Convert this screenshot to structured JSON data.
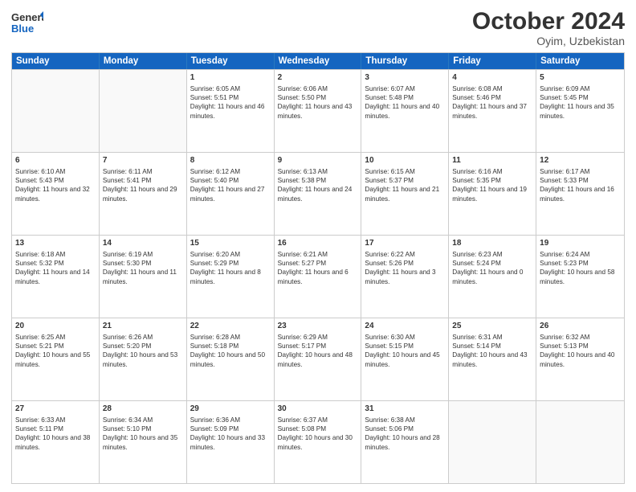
{
  "header": {
    "logo_general": "General",
    "logo_blue": "Blue",
    "month_title": "October 2024",
    "location": "Oyim, Uzbekistan"
  },
  "days_of_week": [
    "Sunday",
    "Monday",
    "Tuesday",
    "Wednesday",
    "Thursday",
    "Friday",
    "Saturday"
  ],
  "weeks": [
    [
      {
        "day": "",
        "sunrise": "",
        "sunset": "",
        "daylight": "",
        "empty": true
      },
      {
        "day": "",
        "sunrise": "",
        "sunset": "",
        "daylight": "",
        "empty": true
      },
      {
        "day": "1",
        "sunrise": "Sunrise: 6:05 AM",
        "sunset": "Sunset: 5:51 PM",
        "daylight": "Daylight: 11 hours and 46 minutes."
      },
      {
        "day": "2",
        "sunrise": "Sunrise: 6:06 AM",
        "sunset": "Sunset: 5:50 PM",
        "daylight": "Daylight: 11 hours and 43 minutes."
      },
      {
        "day": "3",
        "sunrise": "Sunrise: 6:07 AM",
        "sunset": "Sunset: 5:48 PM",
        "daylight": "Daylight: 11 hours and 40 minutes."
      },
      {
        "day": "4",
        "sunrise": "Sunrise: 6:08 AM",
        "sunset": "Sunset: 5:46 PM",
        "daylight": "Daylight: 11 hours and 37 minutes."
      },
      {
        "day": "5",
        "sunrise": "Sunrise: 6:09 AM",
        "sunset": "Sunset: 5:45 PM",
        "daylight": "Daylight: 11 hours and 35 minutes."
      }
    ],
    [
      {
        "day": "6",
        "sunrise": "Sunrise: 6:10 AM",
        "sunset": "Sunset: 5:43 PM",
        "daylight": "Daylight: 11 hours and 32 minutes."
      },
      {
        "day": "7",
        "sunrise": "Sunrise: 6:11 AM",
        "sunset": "Sunset: 5:41 PM",
        "daylight": "Daylight: 11 hours and 29 minutes."
      },
      {
        "day": "8",
        "sunrise": "Sunrise: 6:12 AM",
        "sunset": "Sunset: 5:40 PM",
        "daylight": "Daylight: 11 hours and 27 minutes."
      },
      {
        "day": "9",
        "sunrise": "Sunrise: 6:13 AM",
        "sunset": "Sunset: 5:38 PM",
        "daylight": "Daylight: 11 hours and 24 minutes."
      },
      {
        "day": "10",
        "sunrise": "Sunrise: 6:15 AM",
        "sunset": "Sunset: 5:37 PM",
        "daylight": "Daylight: 11 hours and 21 minutes."
      },
      {
        "day": "11",
        "sunrise": "Sunrise: 6:16 AM",
        "sunset": "Sunset: 5:35 PM",
        "daylight": "Daylight: 11 hours and 19 minutes."
      },
      {
        "day": "12",
        "sunrise": "Sunrise: 6:17 AM",
        "sunset": "Sunset: 5:33 PM",
        "daylight": "Daylight: 11 hours and 16 minutes."
      }
    ],
    [
      {
        "day": "13",
        "sunrise": "Sunrise: 6:18 AM",
        "sunset": "Sunset: 5:32 PM",
        "daylight": "Daylight: 11 hours and 14 minutes."
      },
      {
        "day": "14",
        "sunrise": "Sunrise: 6:19 AM",
        "sunset": "Sunset: 5:30 PM",
        "daylight": "Daylight: 11 hours and 11 minutes."
      },
      {
        "day": "15",
        "sunrise": "Sunrise: 6:20 AM",
        "sunset": "Sunset: 5:29 PM",
        "daylight": "Daylight: 11 hours and 8 minutes."
      },
      {
        "day": "16",
        "sunrise": "Sunrise: 6:21 AM",
        "sunset": "Sunset: 5:27 PM",
        "daylight": "Daylight: 11 hours and 6 minutes."
      },
      {
        "day": "17",
        "sunrise": "Sunrise: 6:22 AM",
        "sunset": "Sunset: 5:26 PM",
        "daylight": "Daylight: 11 hours and 3 minutes."
      },
      {
        "day": "18",
        "sunrise": "Sunrise: 6:23 AM",
        "sunset": "Sunset: 5:24 PM",
        "daylight": "Daylight: 11 hours and 0 minutes."
      },
      {
        "day": "19",
        "sunrise": "Sunrise: 6:24 AM",
        "sunset": "Sunset: 5:23 PM",
        "daylight": "Daylight: 10 hours and 58 minutes."
      }
    ],
    [
      {
        "day": "20",
        "sunrise": "Sunrise: 6:25 AM",
        "sunset": "Sunset: 5:21 PM",
        "daylight": "Daylight: 10 hours and 55 minutes."
      },
      {
        "day": "21",
        "sunrise": "Sunrise: 6:26 AM",
        "sunset": "Sunset: 5:20 PM",
        "daylight": "Daylight: 10 hours and 53 minutes."
      },
      {
        "day": "22",
        "sunrise": "Sunrise: 6:28 AM",
        "sunset": "Sunset: 5:18 PM",
        "daylight": "Daylight: 10 hours and 50 minutes."
      },
      {
        "day": "23",
        "sunrise": "Sunrise: 6:29 AM",
        "sunset": "Sunset: 5:17 PM",
        "daylight": "Daylight: 10 hours and 48 minutes."
      },
      {
        "day": "24",
        "sunrise": "Sunrise: 6:30 AM",
        "sunset": "Sunset: 5:15 PM",
        "daylight": "Daylight: 10 hours and 45 minutes."
      },
      {
        "day": "25",
        "sunrise": "Sunrise: 6:31 AM",
        "sunset": "Sunset: 5:14 PM",
        "daylight": "Daylight: 10 hours and 43 minutes."
      },
      {
        "day": "26",
        "sunrise": "Sunrise: 6:32 AM",
        "sunset": "Sunset: 5:13 PM",
        "daylight": "Daylight: 10 hours and 40 minutes."
      }
    ],
    [
      {
        "day": "27",
        "sunrise": "Sunrise: 6:33 AM",
        "sunset": "Sunset: 5:11 PM",
        "daylight": "Daylight: 10 hours and 38 minutes."
      },
      {
        "day": "28",
        "sunrise": "Sunrise: 6:34 AM",
        "sunset": "Sunset: 5:10 PM",
        "daylight": "Daylight: 10 hours and 35 minutes."
      },
      {
        "day": "29",
        "sunrise": "Sunrise: 6:36 AM",
        "sunset": "Sunset: 5:09 PM",
        "daylight": "Daylight: 10 hours and 33 minutes."
      },
      {
        "day": "30",
        "sunrise": "Sunrise: 6:37 AM",
        "sunset": "Sunset: 5:08 PM",
        "daylight": "Daylight: 10 hours and 30 minutes."
      },
      {
        "day": "31",
        "sunrise": "Sunrise: 6:38 AM",
        "sunset": "Sunset: 5:06 PM",
        "daylight": "Daylight: 10 hours and 28 minutes."
      },
      {
        "day": "",
        "sunrise": "",
        "sunset": "",
        "daylight": "",
        "empty": true
      },
      {
        "day": "",
        "sunrise": "",
        "sunset": "",
        "daylight": "",
        "empty": true
      }
    ]
  ]
}
